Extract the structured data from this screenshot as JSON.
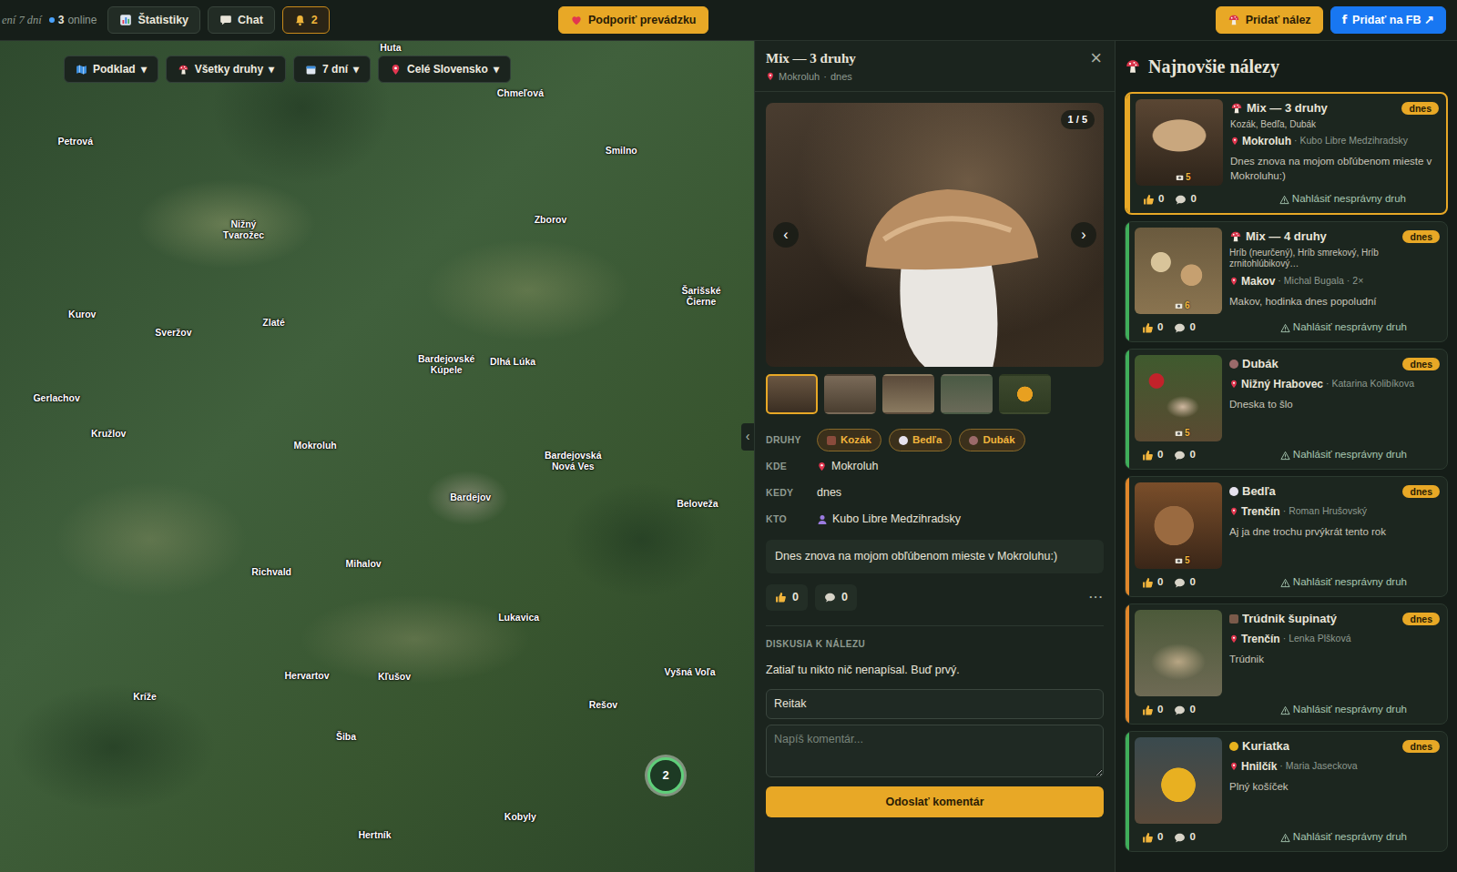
{
  "topbar": {
    "period": "ení 7 dní",
    "online_count": "3",
    "online_label": "online",
    "stats": "Štatistiky",
    "chat": "Chat",
    "alerts": "2",
    "support": "Podporiť prevádzku",
    "add_find": "Pridať nález",
    "fb_logo": "f",
    "add_fb": "Pridať na FB ↗"
  },
  "filters": {
    "caret": "▾",
    "items": [
      {
        "label": "Podklad"
      },
      {
        "label": "Všetky druhy"
      },
      {
        "label": "7 dní"
      },
      {
        "label": "Celé Slovensko"
      }
    ]
  },
  "map": {
    "places": [
      "Huta",
      "Chmeľová",
      "Petrová",
      "Smilno",
      "Nižný Tvarožec",
      "Zborov",
      "Šarišské Čierne",
      "Kurov",
      "Sveržov",
      "Zlaté",
      "Bardejovské Kúpele",
      "Dlhá Lúka",
      "Gerlachov",
      "Kružlov",
      "Mokroluh",
      "Bardejovská Nová Ves",
      "Bardejov",
      "Beloveža",
      "Richvald",
      "Mihalov",
      "Lukavica",
      "Hervartov",
      "Kľušov",
      "Vyšná Voľa",
      "Kríže",
      "Rešov",
      "Šiba",
      "Kobyly",
      "Hertník"
    ],
    "cluster": "2",
    "handle": "‹"
  },
  "detail": {
    "title": "Mix — 3 druhy",
    "location": "Mokroluh",
    "sep": "·",
    "date": "dnes",
    "close": "×",
    "photo_counter": "1 / 5",
    "prev": "‹",
    "next": "›",
    "thumbs": [
      {
        "selected": true
      },
      {
        "selected": false
      },
      {
        "selected": false
      },
      {
        "selected": false
      },
      {
        "selected": false
      }
    ],
    "species_label": "DRUHY",
    "species": [
      {
        "label": "Kozák",
        "kind": "square",
        "color": "#8a4b3c"
      },
      {
        "label": "Bedľa",
        "kind": "circle",
        "color": "#e6e2ee"
      },
      {
        "label": "Dubák",
        "kind": "circle",
        "color": "#9b6a6a"
      }
    ],
    "where_label": "KDE",
    "where": "Mokroluh",
    "when_label": "KEDY",
    "when": "dnes",
    "who_label": "KTO",
    "who": "Kubo Libre Medzihradsky",
    "description": "Dnes znova na mojom obľúbenom mieste v Mokroluhu:)",
    "likes": "0",
    "comments": "0",
    "more": "···",
    "discussion_label": "DISKUSIA K NÁLEZU",
    "empty": "Zatiaľ tu nikto nič nenapísal. Buď prvý.",
    "name_value": "Reitak",
    "comment_placeholder": "Napíš komentár...",
    "submit": "Odoslať komentár"
  },
  "feed": {
    "title": "Najnovšie nálezy",
    "sep": "·",
    "report": "Nahlásiť nesprávny druh",
    "items": [
      {
        "title": "Mix — 3 druhy",
        "kind": "mushroom",
        "icon_color": "#d9344a",
        "species": "Kozák, Bedľa, Dubák",
        "location": "Mokroluh",
        "user": "Kubo Libre Medzihradsky",
        "note": "Dnes znova na mojom obľúbenom mieste v Mokroluhu:)",
        "photos": "5",
        "badge": "dnes",
        "likes": "0",
        "comments": "0",
        "selected": true,
        "color": "#e8a826"
      },
      {
        "title": "Mix — 4 druhy",
        "kind": "mushroom",
        "icon_color": "#d9344a",
        "species": "Hríb (neurčený), Hríb smrekový, Hríb zrnitohlúbikový…",
        "location": "Makov",
        "user": "Michal Bugala",
        "extra": "2×",
        "note": "Makov, hodinka dnes popoludní",
        "photos": "6",
        "badge": "dnes",
        "likes": "0",
        "comments": "0",
        "selected": false,
        "color": "#3fae5a"
      },
      {
        "title": "Dubák",
        "kind": "circle",
        "icon_color": "#9b6a6a",
        "location": "Nižný Hrabovec",
        "user": "Katarina Kolibíkova",
        "note": "Dneska to šlo",
        "photos": "5",
        "badge": "dnes",
        "likes": "0",
        "comments": "0",
        "selected": false,
        "color": "#3fae5a"
      },
      {
        "title": "Bedľa",
        "kind": "circle",
        "icon_color": "#e6e2ee",
        "location": "Trenčín",
        "user": "Roman Hrušovský",
        "note": "Aj ja dne trochu prvýkrát tento rok",
        "photos": "5",
        "badge": "dnes",
        "likes": "0",
        "comments": "0",
        "selected": false,
        "color": "#e0862a"
      },
      {
        "title": "Trúdnik šupinatý",
        "kind": "square",
        "icon_color": "#7a5a4a",
        "location": "Trenčín",
        "user": "Lenka Plšková",
        "note": "Trúdnik",
        "badge": "dnes",
        "likes": "0",
        "comments": "0",
        "selected": false,
        "color": "#e0862a"
      },
      {
        "title": "Kuriatka",
        "kind": "circle",
        "icon_color": "#e8b21e",
        "location": "Hnilčík",
        "user": "Maria Jaseckova",
        "note": "Plný košíček",
        "badge": "dnes",
        "likes": "0",
        "comments": "0",
        "selected": false,
        "color": "#3fae5a"
      }
    ]
  }
}
